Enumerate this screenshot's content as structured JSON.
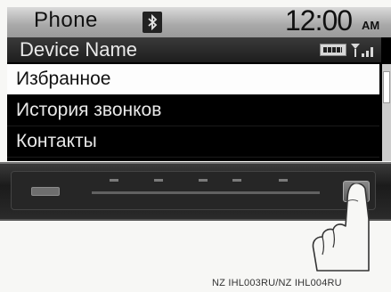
{
  "status_bar": {
    "app_title": "Phone",
    "clock": "12:00",
    "clock_suffix": "AM"
  },
  "device_row": {
    "device_name": "Device Name"
  },
  "menu": {
    "items": [
      {
        "label": "Избранное",
        "selected": true
      },
      {
        "label": "История звонков",
        "selected": false
      },
      {
        "label": "Контакты",
        "selected": false
      }
    ]
  },
  "caption": "NZ IHL003RU/NZ IHL004RU",
  "colors": {
    "status_bar": "#b4b4b4",
    "screen_bg": "#000000",
    "selected_row_bg": "#fdfdfd",
    "panel_bg": "#262626"
  },
  "icons": [
    "bluetooth-icon",
    "battery-icon",
    "signal-icon",
    "finger-pointer-icon"
  ]
}
